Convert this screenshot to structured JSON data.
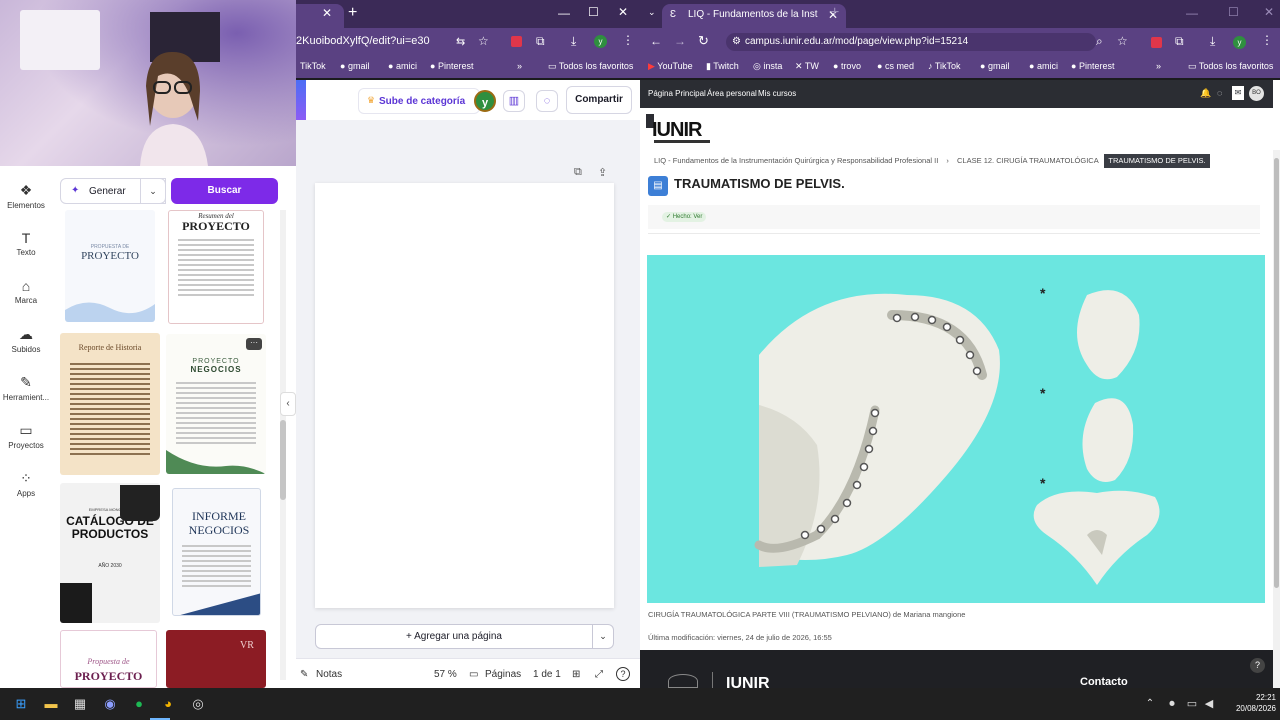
{
  "colors": {
    "browser_frame": "#5a4182",
    "canva_purple": "#7d2ae8",
    "figure_bg": "#6be6e0",
    "site_nav": "#2b2d33"
  },
  "left_browser": {
    "url_fragment": "2KuoibodXylfQ/edit?ui=e30",
    "bookmarks": [
      "TikTok",
      "gmail",
      "amici",
      "Pinterest",
      "Todos los favoritos"
    ]
  },
  "canva": {
    "upgrade_label": "Sube de categoría",
    "avatar_letter": "y",
    "share_label": "Compartir",
    "generate_label": "Generar",
    "search_label": "Buscar",
    "add_page_label": "+ Agregar una página",
    "notes_label": "Notas",
    "zoom": "57 %",
    "pages_label": "Páginas",
    "page_count": "1 de 1",
    "rail": [
      {
        "label": "Elementos",
        "icon": "elements-icon"
      },
      {
        "label": "Texto",
        "icon": "text-icon"
      },
      {
        "label": "Marca",
        "icon": "brand-icon"
      },
      {
        "label": "Subidos",
        "icon": "upload-icon"
      },
      {
        "label": "Herramient...",
        "icon": "tools-icon"
      },
      {
        "label": "Proyectos",
        "icon": "folder-icon"
      },
      {
        "label": "Apps",
        "icon": "apps-icon"
      }
    ],
    "templates": {
      "t1_small": "PROPUESTA DE",
      "t1_big": "PROYECTO",
      "t2_small": "Resumen del",
      "t2_big": "PROYECTO",
      "t3_big": "Reporte de Historia",
      "t4_small": "PROYECTO",
      "t4_big": "NEGOCIOS",
      "t5_small": "EMPRESA MONCELLA",
      "t5_big": "CATÁLOGO DE PRODUCTOS",
      "t5_year": "AÑO 2030",
      "t6_big": "INFORME NEGOCIOS",
      "t7_small": "Propuesta de",
      "t7_big": "PROYECTO",
      "t8_big": "VR"
    }
  },
  "right_browser": {
    "tab_title": "LIQ - Fundamentos de la Instru",
    "url": "campus.iunir.edu.ar/mod/page/view.php?id=15214",
    "bookmarks": [
      "YouTube",
      "Twitch",
      "insta",
      "TW",
      "trovo",
      "cs med",
      "TikTok",
      "gmail",
      "amici",
      "Pinterest",
      "Todos los favoritos"
    ]
  },
  "site": {
    "nav": [
      "Página Principal",
      "Área personal",
      "Mis cursos"
    ],
    "user_initials": "BO",
    "logo": "IUNIR",
    "breadcrumb_course": "LIQ - Fundamentos de la Instrumentación Quirúrgica y Responsabilidad Profesional II",
    "breadcrumb_sep": "›",
    "breadcrumb_class": "CLASE 12. CIRUGÍA TRAUMATOLÓGICA",
    "breadcrumb_active": "TRAUMATISMO DE PELVIS.",
    "title": "TRAUMATISMO DE PELVIS.",
    "done_label": "✓ Hecho: Ver",
    "caption": "CIRUGÍA TRAUMATOLÓGICA PARTE VIII (TRAUMATISMO PELVIANO) de Mariana mangione",
    "last_modified": "Última modificación: viernes, 24 de julio de 2026, 16:55",
    "footer_contact": "Contacto",
    "footer_logo": "IUNIR",
    "asterisk": "*"
  },
  "taskbar": {
    "time": "22:21",
    "date": "20/08/2026"
  }
}
